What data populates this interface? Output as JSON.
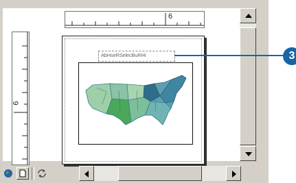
{
  "layout_view": {
    "horizontal_ruler": {
      "label": "6"
    },
    "vertical_ruler": {
      "label": "6"
    },
    "map_title": "AbHseRSelecBuRHi",
    "callout_number": "3"
  },
  "toolbar": {
    "items": [
      {
        "name": "data-view-icon"
      },
      {
        "name": "layout-view-icon"
      },
      {
        "name": "refresh-icon"
      }
    ]
  },
  "colors": {
    "callout": "#1565a8",
    "map_light": "#9fcfa8",
    "map_mid": "#5b9fb0",
    "map_dark": "#2f6e8a",
    "map_green": "#4aa85a"
  }
}
